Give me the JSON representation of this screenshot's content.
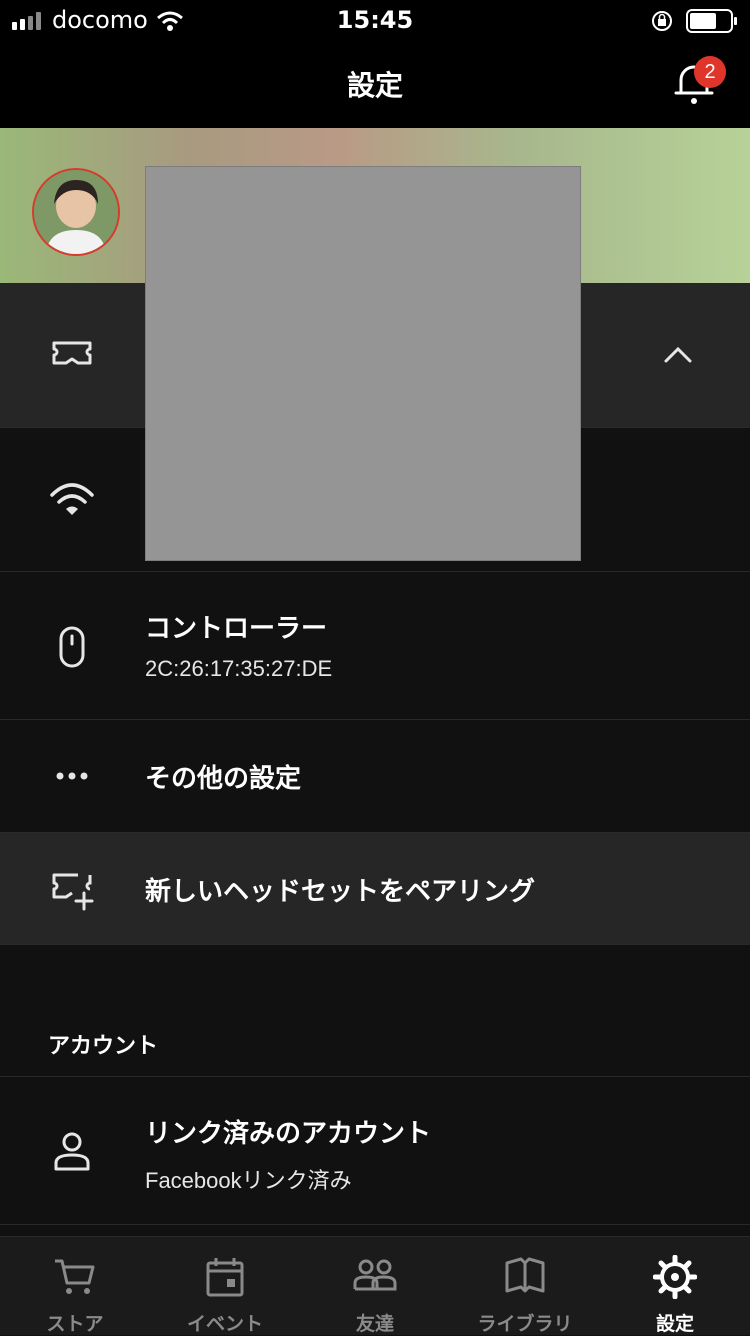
{
  "status_bar": {
    "carrier": "docomo",
    "time": "15:45"
  },
  "nav": {
    "title": "設定",
    "notification_count": "2"
  },
  "device_rows": [
    {
      "label": "コントローラー",
      "sub": "2C:26:17:35:27:DE"
    },
    {
      "label": "その他の設定"
    },
    {
      "label": "新しいヘッドセットをペアリング"
    }
  ],
  "account": {
    "section_title": "アカウント",
    "linked_label": "リンク済みのアカウント",
    "linked_sub": "Facebookリンク済み"
  },
  "tabs": [
    {
      "label": "ストア",
      "icon": "cart-icon"
    },
    {
      "label": "イベント",
      "icon": "calendar-icon"
    },
    {
      "label": "友達",
      "icon": "friends-icon"
    },
    {
      "label": "ライブラリ",
      "icon": "book-icon"
    },
    {
      "label": "設定",
      "icon": "gear-icon",
      "active": true
    }
  ],
  "colors": {
    "accent_red": "#e0352b",
    "background": "#111111"
  }
}
